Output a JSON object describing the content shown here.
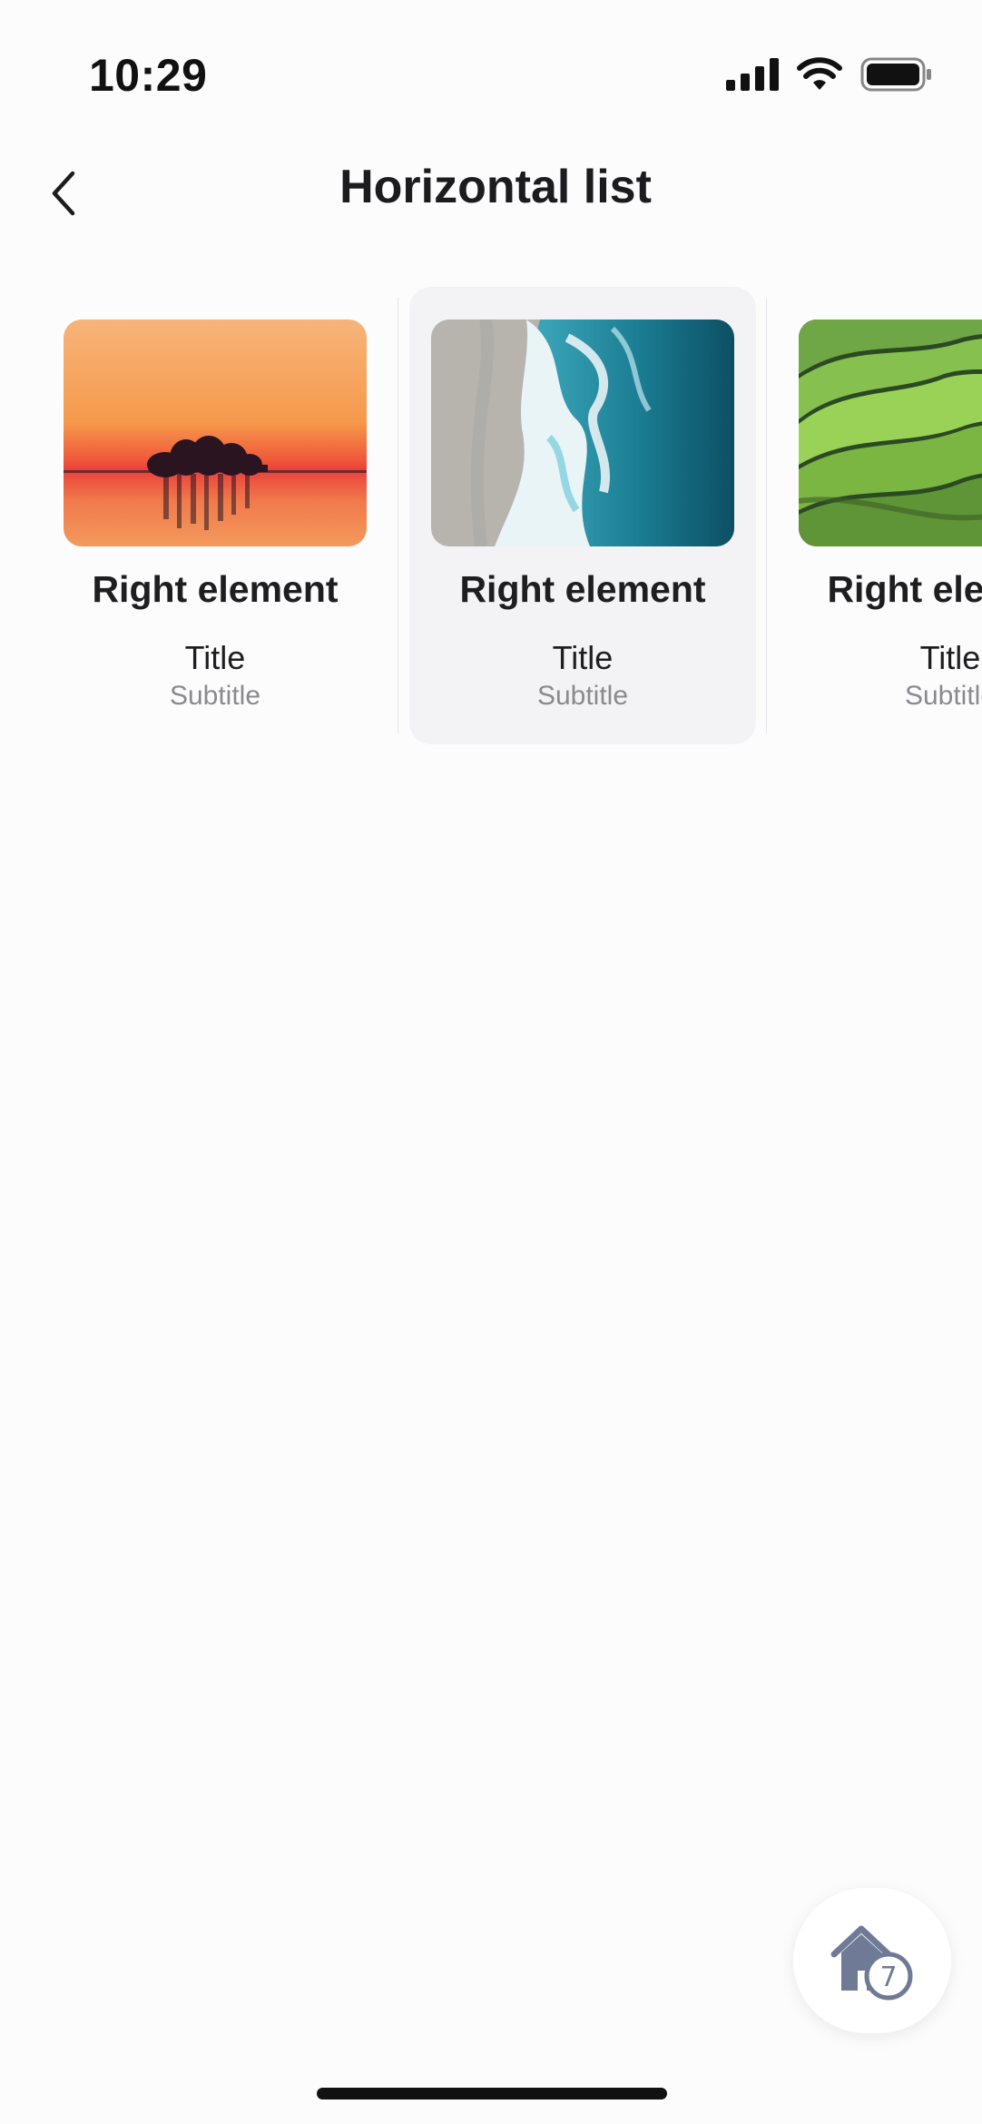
{
  "status_bar": {
    "time": "10:29",
    "icons": [
      "signal-icon",
      "wifi-icon",
      "battery-icon"
    ]
  },
  "nav": {
    "back_icon": "chevron-left-icon",
    "title": "Horizontal list"
  },
  "list": {
    "items": [
      {
        "image": "sunset-lake-island",
        "right_element": "Right element",
        "title": "Title",
        "subtitle": "Subtitle",
        "selected": false
      },
      {
        "image": "ocean-waves-beach",
        "right_element": "Right element",
        "title": "Title",
        "subtitle": "Subtitle",
        "selected": true
      },
      {
        "image": "green-hills",
        "right_element": "Right element",
        "title": "Title",
        "subtitle": "Subtitle",
        "selected": false
      }
    ]
  },
  "fab": {
    "icon": "home-icon",
    "badge": "7"
  },
  "colors": {
    "background": "#fdfcfd",
    "selected_card": "#f3f2f5",
    "text_primary": "#1e1e20",
    "text_secondary": "#8a8a8e",
    "fab_icon": "#6f7a96"
  }
}
